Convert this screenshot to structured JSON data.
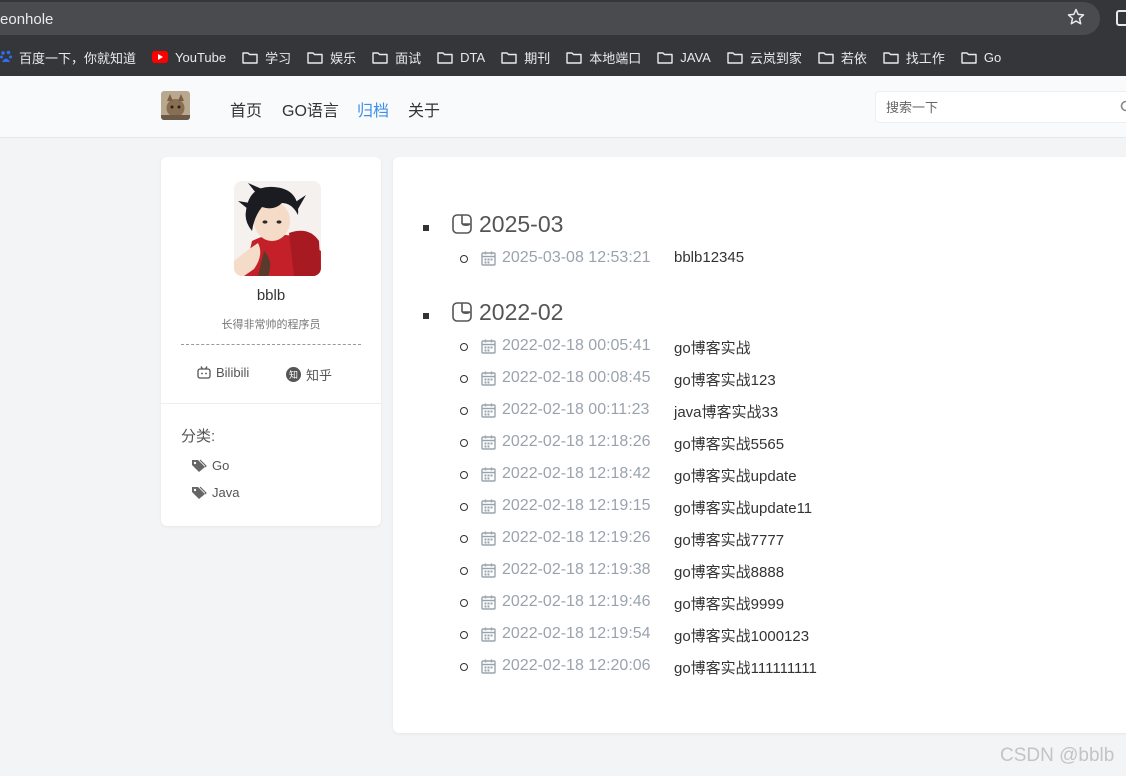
{
  "browser": {
    "url": "pigeonhole",
    "bookmarks": [
      {
        "label": "百度一下，你就知道",
        "icon": "baidu-icon"
      },
      {
        "label": "YouTube",
        "icon": "youtube-icon"
      },
      {
        "label": "学习",
        "icon": "folder-icon"
      },
      {
        "label": "娱乐",
        "icon": "folder-icon"
      },
      {
        "label": "面试",
        "icon": "folder-icon"
      },
      {
        "label": "DTA",
        "icon": "folder-icon"
      },
      {
        "label": "期刊",
        "icon": "folder-icon"
      },
      {
        "label": "本地端口",
        "icon": "folder-icon"
      },
      {
        "label": "JAVA",
        "icon": "folder-icon"
      },
      {
        "label": "云岚到家",
        "icon": "folder-icon"
      },
      {
        "label": "若依",
        "icon": "folder-icon"
      },
      {
        "label": "找工作",
        "icon": "folder-icon"
      },
      {
        "label": "Go",
        "icon": "folder-icon"
      }
    ]
  },
  "header": {
    "nav": [
      "首页",
      "GO语言",
      "归档",
      "关于"
    ],
    "active_nav": "归档",
    "search_placeholder": "搜索一下"
  },
  "profile": {
    "username": "bblb",
    "bio": "长得非常帅的程序员",
    "links": [
      "Bilibili",
      "知乎"
    ],
    "zhihu_badge": "知",
    "categories_title": "分类:",
    "categories": [
      "Go",
      "Java"
    ]
  },
  "archive": [
    {
      "month": "2025-03",
      "entries": [
        {
          "date": "2025-03-08 12:53:21",
          "title": "bblb12345"
        }
      ]
    },
    {
      "month": "2022-02",
      "entries": [
        {
          "date": "2022-02-18 00:05:41",
          "title": "go博客实战"
        },
        {
          "date": "2022-02-18 00:08:45",
          "title": "go博客实战123"
        },
        {
          "date": "2022-02-18 00:11:23",
          "title": "java博客实战33"
        },
        {
          "date": "2022-02-18 12:18:26",
          "title": "go博客实战5565"
        },
        {
          "date": "2022-02-18 12:18:42",
          "title": "go博客实战update"
        },
        {
          "date": "2022-02-18 12:19:15",
          "title": "go博客实战update11"
        },
        {
          "date": "2022-02-18 12:19:26",
          "title": "go博客实战7777"
        },
        {
          "date": "2022-02-18 12:19:38",
          "title": "go博客实战8888"
        },
        {
          "date": "2022-02-18 12:19:46",
          "title": "go博客实战9999"
        },
        {
          "date": "2022-02-18 12:19:54",
          "title": "go博客实战1000123"
        },
        {
          "date": "2022-02-18 12:20:06",
          "title": "go博客实战111111111"
        }
      ]
    }
  ],
  "watermark": "CSDN @bblb",
  "colors": {
    "accent": "#3b8eea",
    "chrome": "#35363a",
    "date": "#9aa3ad"
  }
}
